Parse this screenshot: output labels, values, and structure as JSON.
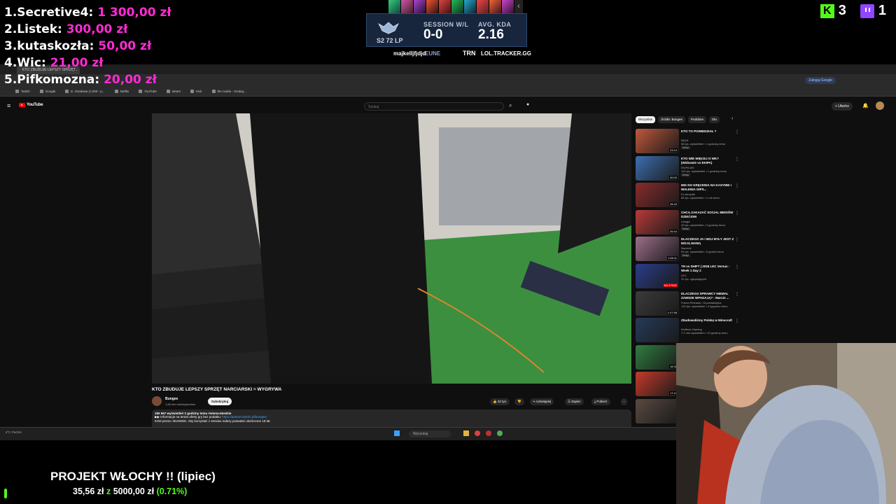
{
  "leaderboard": [
    {
      "rank": "1.",
      "name": "Secretive4:",
      "amount": "1 300,00 zł"
    },
    {
      "rank": "2.",
      "name": "Listek:",
      "amount": "300,00 zł"
    },
    {
      "rank": "3.",
      "name": "kutaskozła:",
      "amount": "50,00 zł"
    },
    {
      "rank": "4.",
      "name": "Wic:",
      "amount": "21,00 zł"
    },
    {
      "rank": "5.",
      "name": "Pifkomozna:",
      "amount": "20,00 zł"
    }
  ],
  "lol": {
    "lp": "S2 72 LP",
    "session_label": "SESSION W/L",
    "session_value": "0-0",
    "kda_label": "AVG. KDA",
    "kda_value": "2.16",
    "summoner": "majkelljfjdjd",
    "region": "EUNE",
    "trn": "TRN",
    "tracker": "LOL.TRACKER.GG"
  },
  "socials": {
    "kick_count": "3",
    "twitch_count": "1",
    "kick_logo": "K"
  },
  "browser": {
    "tab_title": "KTO ZBUDUJE LEPSZY SPRZĘT...",
    "google_button": "Zaloguj Google",
    "bookmarks": [
      "Twitch",
      "Google",
      "E. Osiołowa (1.000 - p...",
      "Netflix",
      "YouTube",
      "steam",
      "Kick",
      "the rookie - Szukaj..."
    ]
  },
  "youtube": {
    "logo_text": "YouTube",
    "search_placeholder": "Szukaj",
    "create_label": "+ Utwórz",
    "video_title": "KTO ZBUDUJE LEPSZY SPRZĘT NARCIARSKI = WYGRYWA",
    "channel": "Bungee",
    "subscribers": "1,66 mln subskrybentów",
    "subscribe_label": "Subskrybuj",
    "likes": "22 tys.",
    "share_label": "Udostępnij",
    "save_label": "Zapisz",
    "download_label": "Pobierz",
    "desc_meta": "150 557 wyświetleń  2 godziny temu  #wiemcobedzie",
    "desc_line1": "▶▶ Informacje na temat oferty gry bez podatku: ",
    "desc_link": "https://partner.betclic.pl/bungee/",
    "desc_line2": "KOD promo: BUNGEE. Aby korzystać z serwisu należy posiadać ukończone 18 lat.",
    "chips": [
      "Wszystkie",
      "Źródło: Bungee",
      "Podobne",
      "Dla"
    ],
    "recommendations": [
      {
        "title": "KTO TO POWIEDZIAŁ ?",
        "channel": "BAZA",
        "meta": "56 tys. wyświetleń • 1 godzinę temu",
        "badge": "Nowy",
        "duration": "23:10"
      },
      {
        "title": "KTO WIE WIĘCEJ O WK? (Widzowie vs EKIPA)",
        "channel": "EKIPA WK",
        "meta": "113 tys. wyświetleń • 1 godzinę temu",
        "badge": "Nowy",
        "duration": "40:00"
      },
      {
        "title": "MIX DO KRĘCENIA NA KASYNIE I WALENIA GIPS...",
        "channel": "Dr skrzydło",
        "meta": "86 tys. wyświetleń • 1 rok temu",
        "badge": "",
        "duration": "28:43"
      },
      {
        "title": "CHCĄ ZAKAZAĆ SOCIAL MEDIÓW DZIECIOM",
        "channel": "Uwaga",
        "meta": "40 tys. wyświetleń • 3 godziny temu",
        "badge": "Nowy",
        "duration": "26:44"
      },
      {
        "title": "DLACZEGO JA I MOJ BYŁY JEST Z MOJĄ MAMĄ",
        "channel": "Narcicół",
        "meta": "54 tys. wyświetleń • 5 godzin temu",
        "badge": "Nowy",
        "duration": "1:08:11"
      },
      {
        "title": "TH vs SHIFT | 2026 LEC Versus - Week 1 Day 2",
        "channel": "LEC",
        "meta": "31 tys. oglądających",
        "badge": "",
        "duration": "NA ŻYWO"
      },
      {
        "title": "DLACZEGO SPRAWCY NIEMAL ZAWSZE WPADAJĄ? - Marcin ...",
        "channel": "Frema Pietrasik • Kryminalistyka",
        "meta": "132 tys. wyświetleń • 3 tygodnie temu",
        "badge": "",
        "duration": "1:07:58"
      },
      {
        "title": "Zbudowaliśmy Polskę w Minecraft",
        "channel": "Wolfrest Gaming",
        "meta": "7,2 mln wyświetleń • 23 godziny temu",
        "badge": "",
        "duration": ""
      },
      {
        "title": "",
        "channel": "",
        "meta": "",
        "badge": "",
        "duration": "18:32"
      },
      {
        "title": "",
        "channel": "",
        "meta": "",
        "badge": "",
        "duration": "17:10"
      },
      {
        "title": "",
        "channel": "",
        "meta": "",
        "badge": "",
        "duration": ""
      }
    ]
  },
  "taskbar": {
    "search_placeholder": "Wyszukaj",
    "weather": "4°C Pochm."
  },
  "goal": {
    "title": "PROJEKT WŁOCHY !! (lipiec)",
    "current": "35,56 zł",
    "sep": " z ",
    "target": "5000,00 zł",
    "pct": "(0.71%)",
    "progress_fraction": 0.0071
  }
}
